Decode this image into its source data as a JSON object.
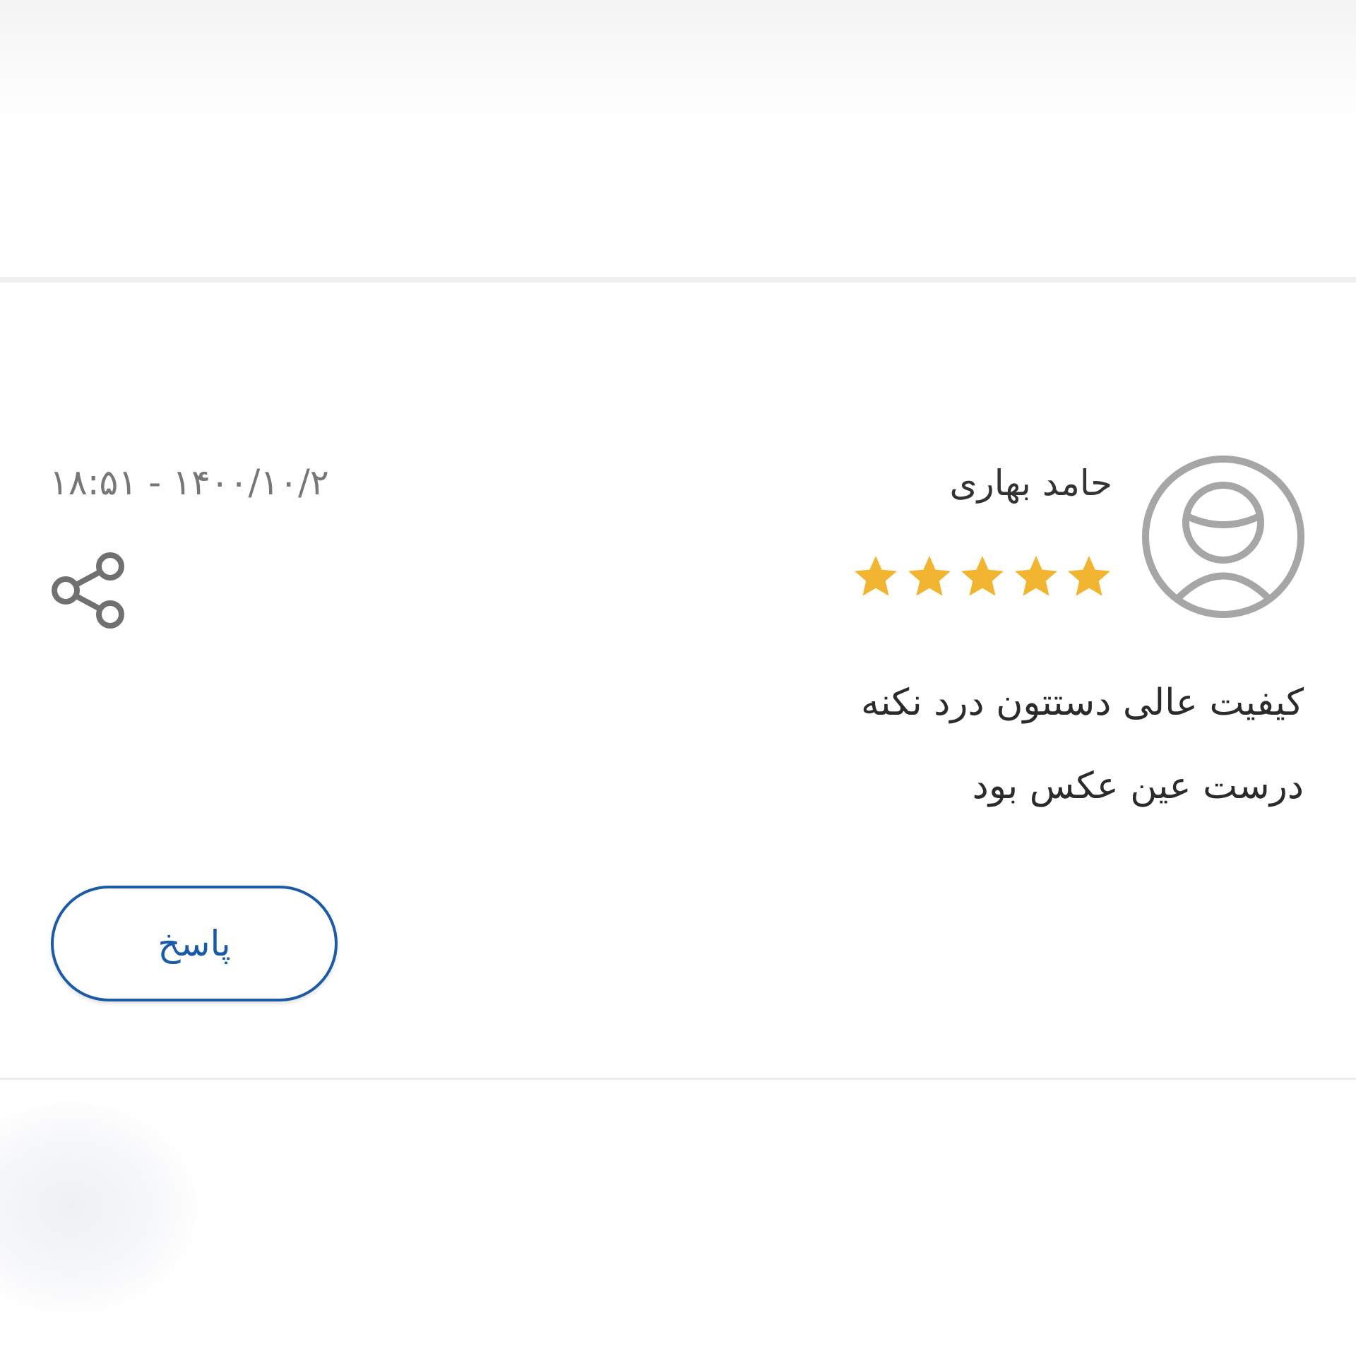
{
  "review": {
    "user_name": "حامد بهاری",
    "rating": 5,
    "rating_max": 5,
    "timestamp": "۱۸:۵۱ - ۱۴۰۰/۱۰/۲",
    "comment_lines": [
      "کیفیت عالی دستتون درد نکنه",
      "درست عین عکس بود"
    ],
    "reply_label": "پاسخ"
  },
  "icons": {
    "avatar": "user-avatar-icon",
    "share": "share-icon",
    "star": "star-icon"
  },
  "colors": {
    "star": "#f2b532",
    "accent": "#1a5aa6",
    "avatar_gray": "#a6a6a6",
    "share_gray": "#707070"
  }
}
